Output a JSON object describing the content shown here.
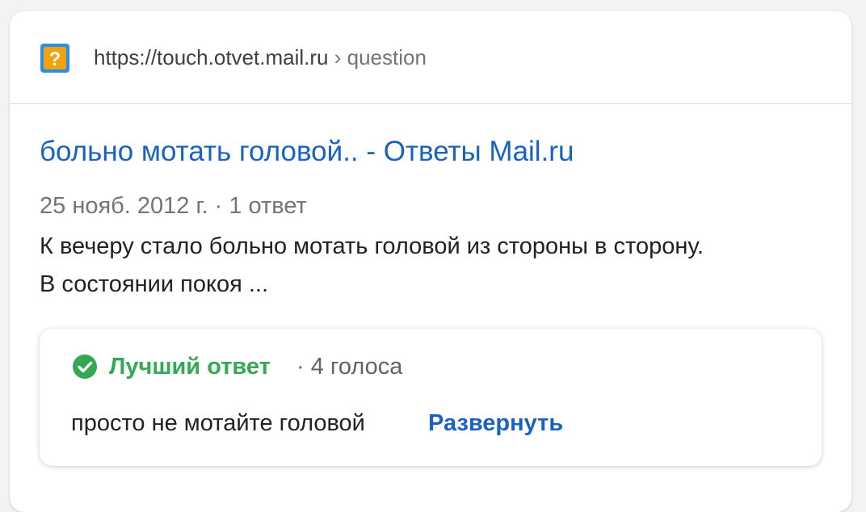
{
  "source": {
    "favicon_icon": "question-mark-icon",
    "url": "https://touch.otvet.mail.ru",
    "separator": "›",
    "path": "question"
  },
  "result": {
    "title": "больно мотать головой.. - Ответы Mail.ru",
    "meta": "25 нояб. 2012 г. · 1 ответ",
    "snippet_line1": "К вечеру стало больно мотать головой из стороны в сторону.",
    "snippet_line2": "В состоянии покоя ..."
  },
  "best_answer": {
    "icon": "check-circle-icon",
    "label": "Лучший ответ",
    "votes": "· 4 голоса",
    "text": "просто не мотайте головой",
    "expand_label": "Развернуть"
  },
  "colors": {
    "link": "#1a62c0",
    "best_answer_green": "#34a853",
    "favicon_orange": "#f2a20c",
    "favicon_blue": "#2d8ee6"
  }
}
